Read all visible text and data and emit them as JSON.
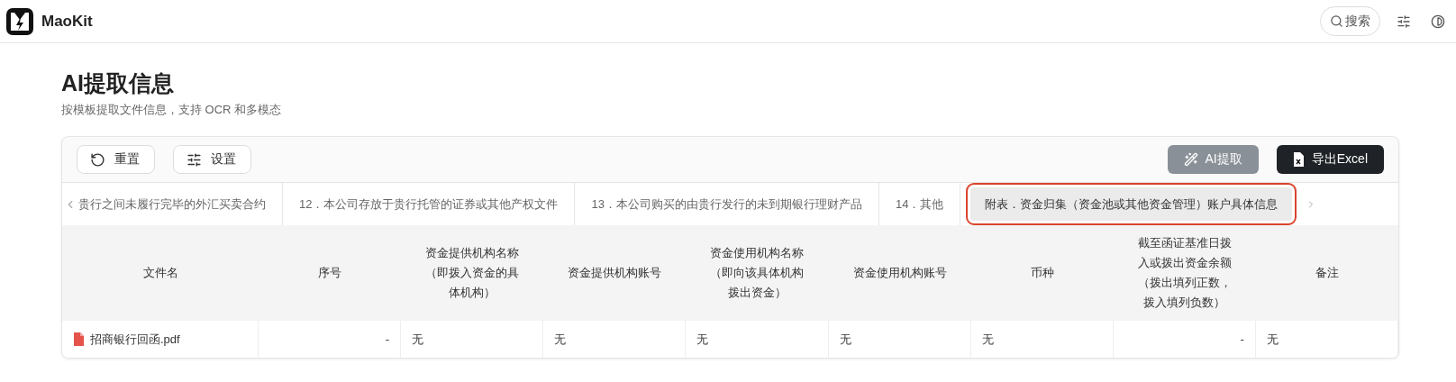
{
  "header": {
    "brand": "MaoKit",
    "search_label": "搜索"
  },
  "page": {
    "title": "AI提取信息",
    "subtitle": "按模板提取文件信息，支持 OCR 和多模态"
  },
  "toolbar": {
    "left_buttons": [
      "重置",
      "设置"
    ],
    "ai_button": {
      "label": "AI提取",
      "disabled": true
    },
    "export_button": "导出Excel"
  },
  "tabs": [
    {
      "label": "贵行之间未履行完毕的外汇买卖合约",
      "selected": false
    },
    {
      "label": "12．本公司存放于贵行托管的证券或其他产权文件",
      "selected": false
    },
    {
      "label": "13．本公司购买的由贵行发行的未到期银行理财产品",
      "selected": false
    },
    {
      "label": "14．其他",
      "selected": false
    },
    {
      "label": "附表．资金归集（资金池或其他资金管理）账户具体信息",
      "selected": true
    }
  ],
  "table": {
    "columns": [
      "文件名",
      "序号",
      "资金提供机构名称（即拨入资金的具体机构）",
      "资金提供机构账号",
      "资金使用机构名称（即向该具体机构拨出资金）",
      "资金使用机构账号",
      "币种",
      "截至函证基准日拨入或拨出资金余额（拨出填列正数，拨入填列负数）",
      "备注"
    ],
    "rows": [
      {
        "cells": [
          "招商银行回函.pdf",
          "-",
          "无",
          "无",
          "无",
          "无",
          "无",
          "-",
          "无"
        ]
      }
    ]
  }
}
